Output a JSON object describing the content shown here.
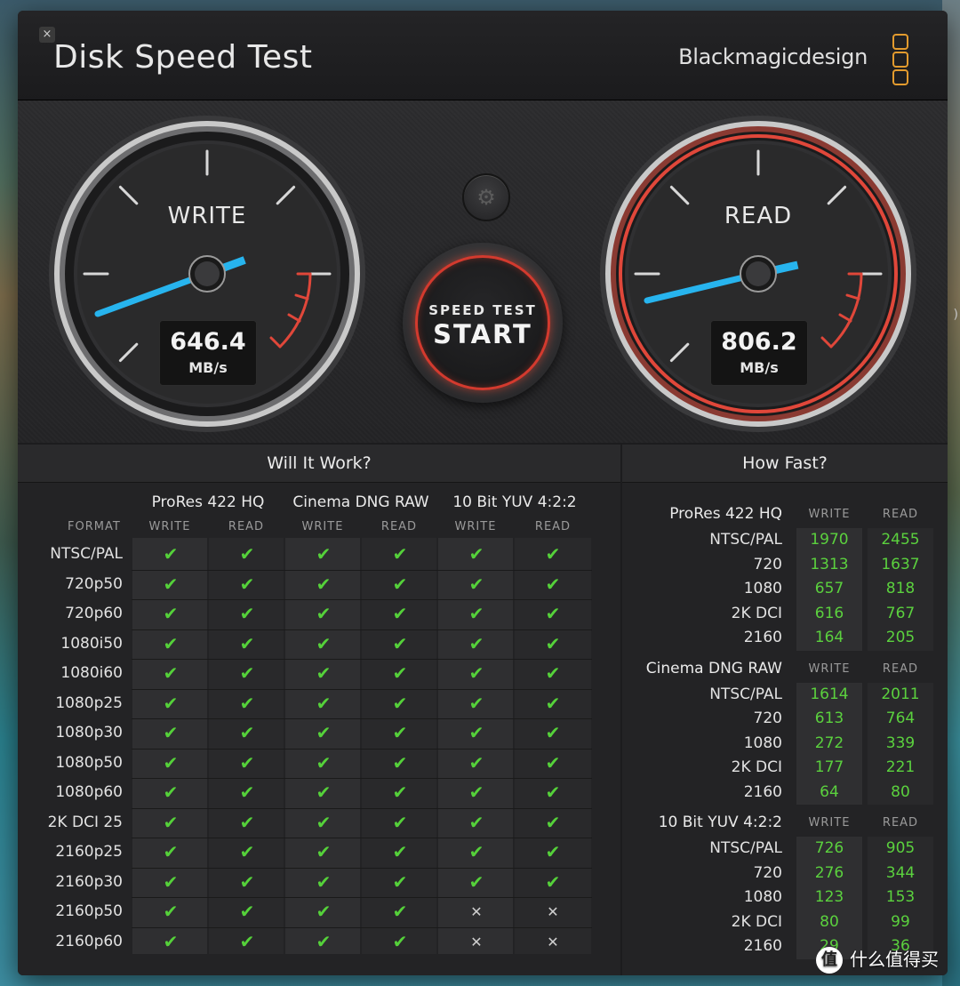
{
  "window": {
    "close_glyph": "×",
    "title": "Disk Speed Test",
    "brand": "Blackmagicdesign",
    "accent_orange": "#e39b2e"
  },
  "gauges": {
    "write": {
      "label": "WRITE",
      "value": "646.4",
      "unit": "MB/s",
      "needle_color": "#27b4ee"
    },
    "read": {
      "label": "READ",
      "value": "806.2",
      "unit": "MB/s",
      "needle_color": "#27b4ee",
      "ring_color": "#d33a2e"
    }
  },
  "start_button": {
    "sub_label": "SPEED TEST",
    "main_label": "START"
  },
  "settings_icon": "gear-icon",
  "will_it_work": {
    "title": "Will It Work?",
    "format_header": "FORMAT",
    "groups": [
      "ProRes 422 HQ",
      "Cinema DNG RAW",
      "10 Bit YUV 4:2:2"
    ],
    "write_label": "WRITE",
    "read_label": "READ",
    "ok_glyph": "✔",
    "no_glyph": "✕",
    "rows": [
      {
        "format": "NTSC/PAL",
        "marks": [
          1,
          1,
          1,
          1,
          1,
          1
        ]
      },
      {
        "format": "720p50",
        "marks": [
          1,
          1,
          1,
          1,
          1,
          1
        ]
      },
      {
        "format": "720p60",
        "marks": [
          1,
          1,
          1,
          1,
          1,
          1
        ]
      },
      {
        "format": "1080i50",
        "marks": [
          1,
          1,
          1,
          1,
          1,
          1
        ]
      },
      {
        "format": "1080i60",
        "marks": [
          1,
          1,
          1,
          1,
          1,
          1
        ]
      },
      {
        "format": "1080p25",
        "marks": [
          1,
          1,
          1,
          1,
          1,
          1
        ]
      },
      {
        "format": "1080p30",
        "marks": [
          1,
          1,
          1,
          1,
          1,
          1
        ]
      },
      {
        "format": "1080p50",
        "marks": [
          1,
          1,
          1,
          1,
          1,
          1
        ]
      },
      {
        "format": "1080p60",
        "marks": [
          1,
          1,
          1,
          1,
          1,
          1
        ]
      },
      {
        "format": "2K DCI 25",
        "marks": [
          1,
          1,
          1,
          1,
          1,
          1
        ]
      },
      {
        "format": "2160p25",
        "marks": [
          1,
          1,
          1,
          1,
          1,
          1
        ]
      },
      {
        "format": "2160p30",
        "marks": [
          1,
          1,
          1,
          1,
          1,
          1
        ]
      },
      {
        "format": "2160p50",
        "marks": [
          1,
          1,
          1,
          1,
          0,
          0
        ]
      },
      {
        "format": "2160p60",
        "marks": [
          1,
          1,
          1,
          1,
          0,
          0
        ]
      }
    ]
  },
  "how_fast": {
    "title": "How Fast?",
    "write_label": "WRITE",
    "read_label": "READ",
    "groups": [
      {
        "name": "ProRes 422 HQ",
        "rows": [
          {
            "format": "NTSC/PAL",
            "write": "1970",
            "read": "2455"
          },
          {
            "format": "720",
            "write": "1313",
            "read": "1637"
          },
          {
            "format": "1080",
            "write": "657",
            "read": "818"
          },
          {
            "format": "2K DCI",
            "write": "616",
            "read": "767"
          },
          {
            "format": "2160",
            "write": "164",
            "read": "205"
          }
        ]
      },
      {
        "name": "Cinema DNG RAW",
        "rows": [
          {
            "format": "NTSC/PAL",
            "write": "1614",
            "read": "2011"
          },
          {
            "format": "720",
            "write": "613",
            "read": "764"
          },
          {
            "format": "1080",
            "write": "272",
            "read": "339"
          },
          {
            "format": "2K DCI",
            "write": "177",
            "read": "221"
          },
          {
            "format": "2160",
            "write": "64",
            "read": "80"
          }
        ]
      },
      {
        "name": "10 Bit YUV 4:2:2",
        "rows": [
          {
            "format": "NTSC/PAL",
            "write": "726",
            "read": "905"
          },
          {
            "format": "720",
            "write": "276",
            "read": "344"
          },
          {
            "format": "1080",
            "write": "123",
            "read": "153"
          },
          {
            "format": "2K DCI",
            "write": "80",
            "read": "99"
          },
          {
            "format": "2160",
            "write": "29",
            "read": "36"
          }
        ]
      }
    ]
  },
  "watermark": {
    "icon_glyph": "值",
    "text": "什么值得买"
  },
  "right_edge_glyph": ")"
}
